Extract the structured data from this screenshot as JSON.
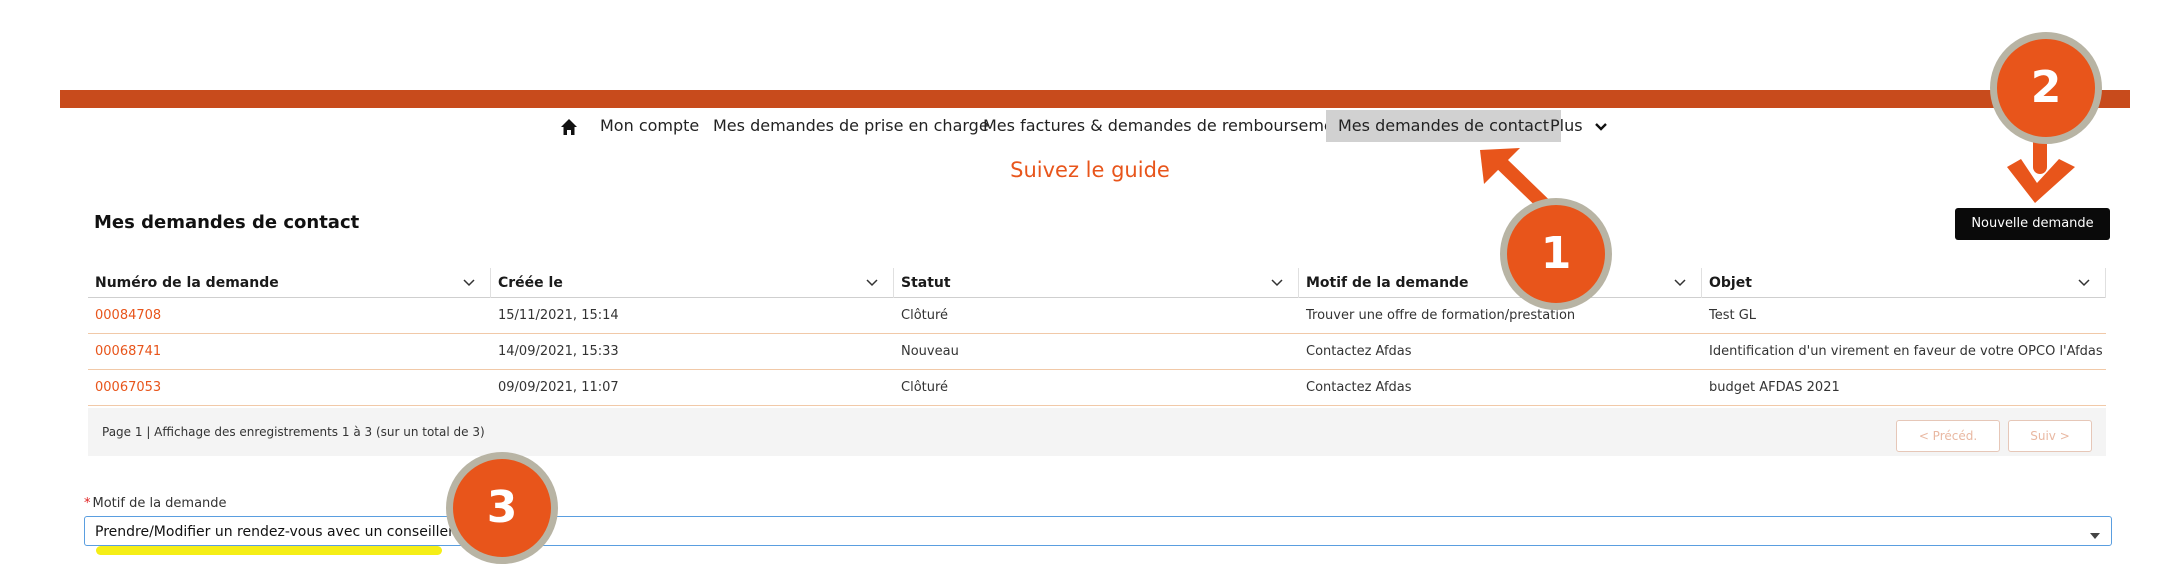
{
  "nav": {
    "items": [
      {
        "label": "Mon compte"
      },
      {
        "label": "Mes demandes de prise en charge"
      },
      {
        "label": "Mes factures & demandes de remboursement"
      },
      {
        "label": "Mes demandes de contact"
      },
      {
        "label": "Plus"
      }
    ],
    "active_index": 3,
    "home_icon": "home-icon"
  },
  "guide": {
    "title": "Suivez le guide"
  },
  "section": {
    "title": "Mes demandes de contact",
    "new_button": "Nouvelle demande"
  },
  "table": {
    "columns": [
      "Numéro de la demande",
      "Créée le",
      "Statut",
      "Motif de la demande",
      "Objet"
    ],
    "rows": [
      [
        "00084708",
        "15/11/2021, 15:14",
        "Clôturé",
        "Trouver une offre de formation/prestation",
        "Test GL"
      ],
      [
        "00068741",
        "14/09/2021, 15:33",
        "Nouveau",
        "Contactez Afdas",
        "Identification d'un virement en faveur de votre OPCO l'Afdas"
      ],
      [
        "00067053",
        "09/09/2021, 11:07",
        "Clôturé",
        "Contactez Afdas",
        "budget AFDAS 2021"
      ]
    ]
  },
  "pager": {
    "text": "Page 1 | Affichage des enregistrements 1 à 3 (sur un total de 3)",
    "prev": "< Précéd.",
    "next": "Suiv >"
  },
  "form": {
    "label": "Motif de la demande",
    "required_mark": "*",
    "value": "Prendre/Modifier un rendez-vous avec un conseiller"
  },
  "annotations": {
    "badges": [
      "1",
      "2",
      "3"
    ],
    "accent_color": "#e8551b",
    "highlight_color": "#f5ee17"
  }
}
